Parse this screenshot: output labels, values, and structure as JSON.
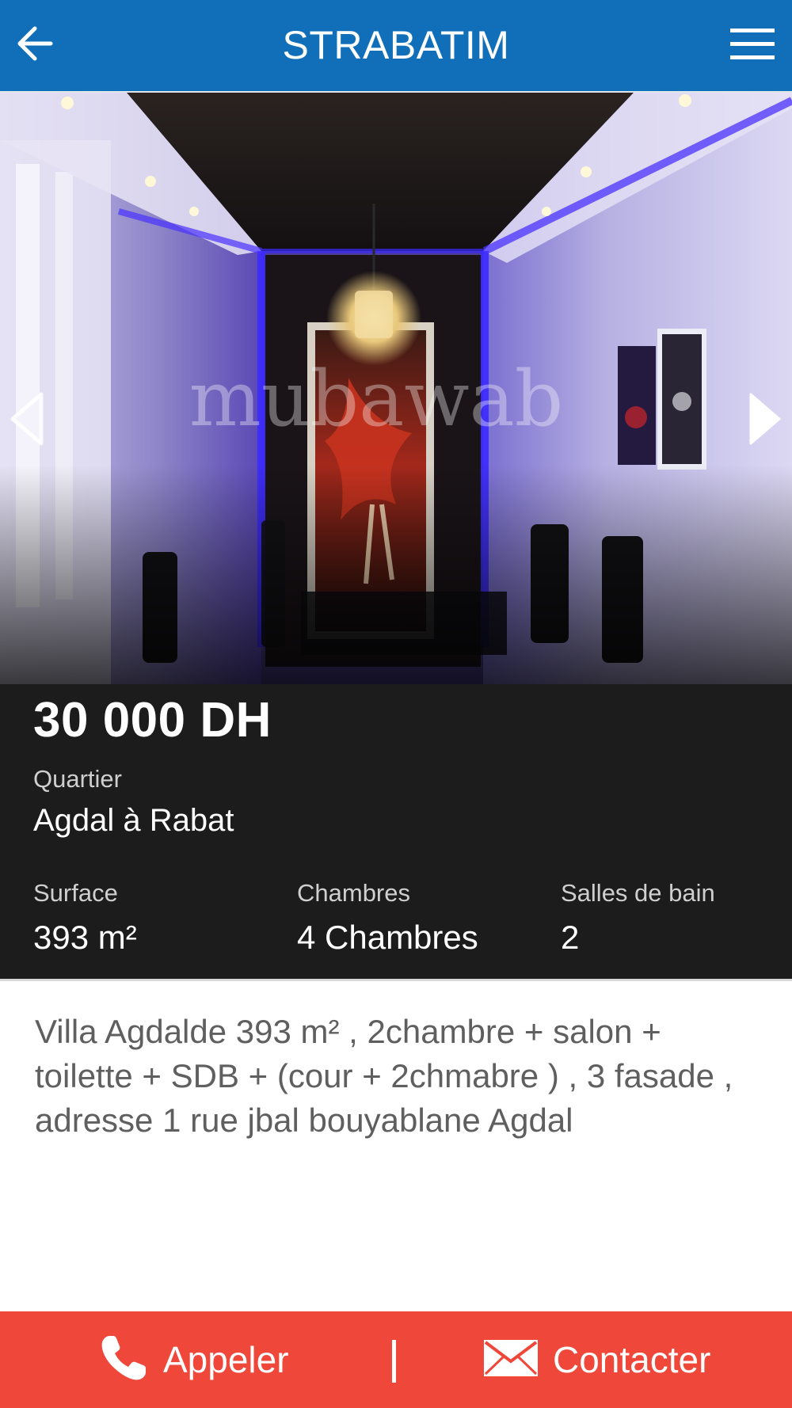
{
  "header": {
    "title": "STRABATIM",
    "color": "#106fb8",
    "back_icon": "arrow-left-icon",
    "menu_icon": "hamburger-menu-icon"
  },
  "gallery": {
    "watermark": "mubawab",
    "prev_icon": "chevron-left-icon",
    "next_icon": "chevron-right-icon"
  },
  "listing": {
    "price": "30 000 DH",
    "quartier_label": "Quartier",
    "quartier_value": "Agdal à Rabat",
    "stats": [
      {
        "label": "Surface",
        "value": "393 m²"
      },
      {
        "label": "Chambres",
        "value": "4 Chambres"
      },
      {
        "label": "Salles de bain",
        "value": "2"
      }
    ],
    "description": "Villa Agdalde 393 m² , 2chambre + salon + toilette + SDB + (cour + 2chmabre ) , 3 fasade , adresse 1 rue jbal bouyablane Agdal"
  },
  "actions": {
    "call_label": "Appeler",
    "call_icon": "phone-icon",
    "separator": "|",
    "contact_label": "Contacter",
    "contact_icon": "envelope-icon",
    "color": "#ef473a"
  }
}
